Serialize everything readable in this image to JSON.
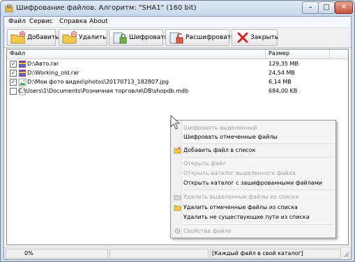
{
  "window": {
    "title": "Шифрование файлов. Алгоритм: \"SHA1\" (160 bit)",
    "min_glyph": "–",
    "max_glyph": "□",
    "close_glyph": "✕"
  },
  "menu": [
    "Файл",
    "Сервис",
    "Справка",
    "About"
  ],
  "toolbar": {
    "add": "Добавить",
    "remove": "Удалить",
    "encrypt": "Шифровать",
    "decrypt": "Расшифровать",
    "close": "Закрыть"
  },
  "columns": {
    "file": "Файл",
    "size": "Размер"
  },
  "files": [
    {
      "name": "D:\\Авто.rar",
      "size": "129,35 MB",
      "checked": true
    },
    {
      "name": "D:\\Working_old.rar",
      "size": "24,54 MB",
      "checked": true
    },
    {
      "name": "D:\\Мои фото видео\\photos\\20170713_182807.jpg",
      "size": "6,14 MB",
      "checked": true
    },
    {
      "name": "C:\\Users\\1\\Documents\\Розничная торговля\\DB\\shopdb.mdb",
      "size": "684,00 KB",
      "checked": false
    }
  ],
  "status": {
    "percent": "0%",
    "mode": "[Каждый файл в свой каталог]"
  },
  "context_menu": {
    "encrypt_selected": "Шифровать выделенный",
    "encrypt_checked": "Шифровать отмеченные файлы",
    "add_file": "Добавить файл в список",
    "open_file": "Открыть файл",
    "open_folder_selected": "Открыть каталог выделенного файла",
    "open_folder_encrypted": "Открыть каталог с зашифрованными файлами",
    "remove_selected": "Удалить выделенные файлы из списка",
    "remove_checked": "Удалить отмеченные файлы из списка",
    "remove_missing": "Удалить не существующие пути из списка",
    "file_properties": "Свойства файла"
  },
  "colors": {
    "accent": "#3c78c8",
    "disabled_text": "#a3a3a3"
  }
}
